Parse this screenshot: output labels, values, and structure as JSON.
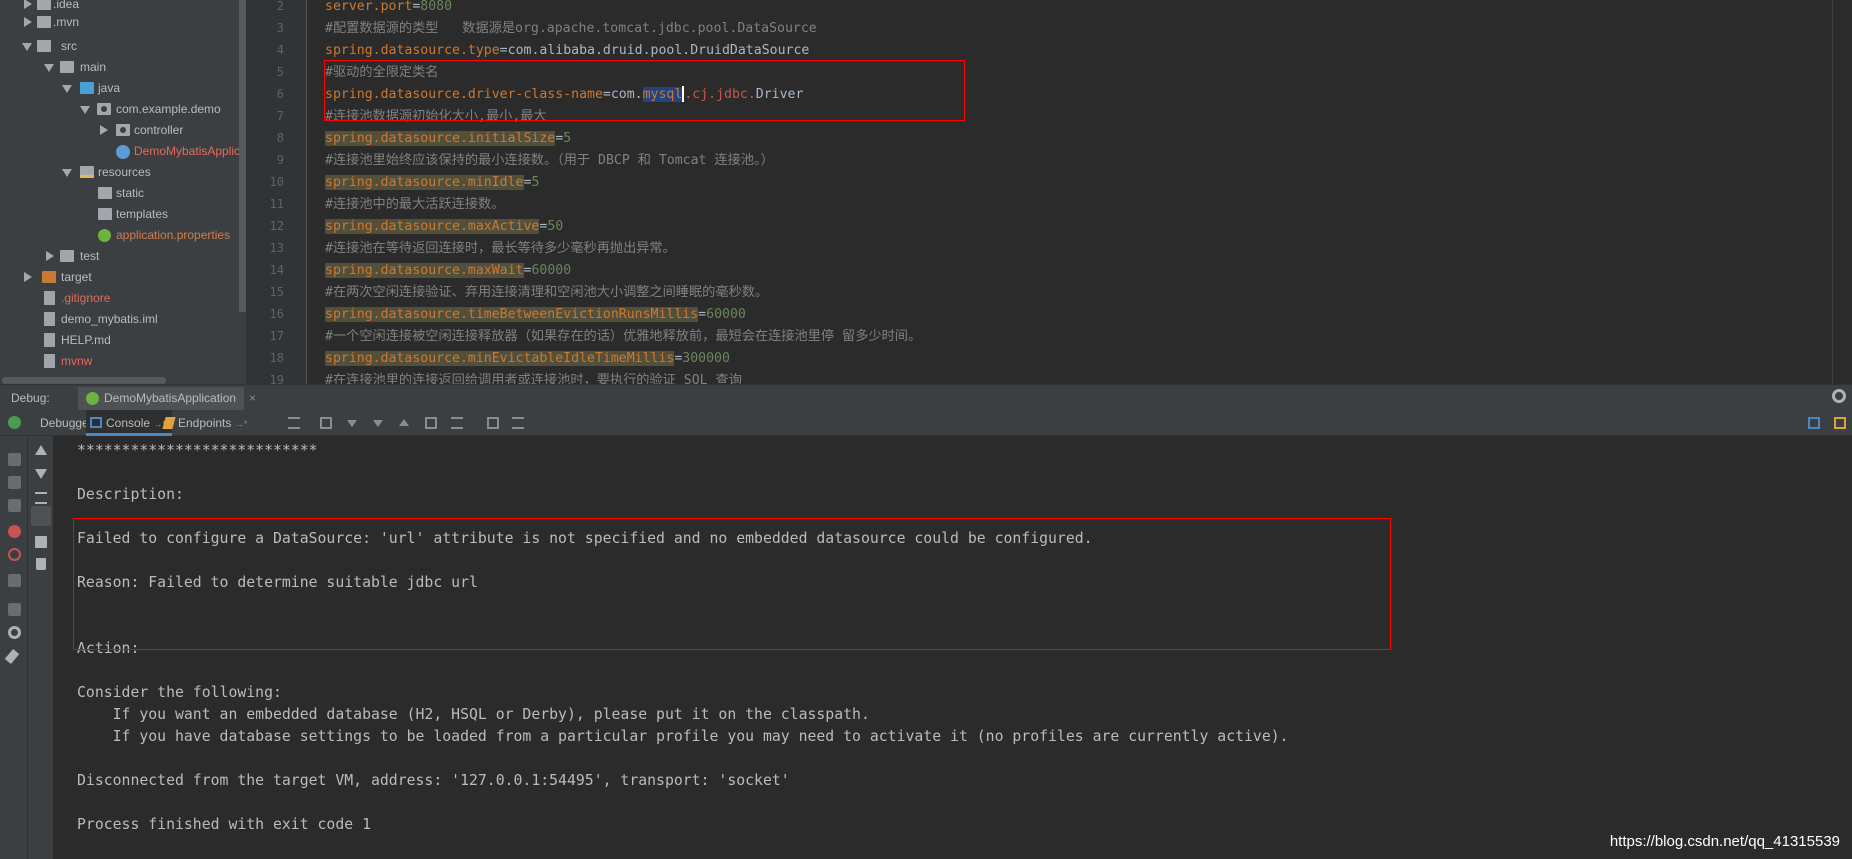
{
  "project_tree": {
    "items": [
      {
        "label": ".idea",
        "icon": "folder-icon"
      },
      {
        "label": ".mvn",
        "icon": "folder-icon"
      },
      {
        "label": "src",
        "icon": "folder-icon"
      },
      {
        "label": "main",
        "icon": "folder-icon"
      },
      {
        "label": "java",
        "icon": "source-folder-icon"
      },
      {
        "label": "com.example.demo",
        "icon": "package-icon"
      },
      {
        "label": "controller",
        "icon": "package-icon"
      },
      {
        "label": "DemoMybatisApplic",
        "icon": "spring-boot-class-icon"
      },
      {
        "label": "resources",
        "icon": "resources-folder-icon"
      },
      {
        "label": "static",
        "icon": "folder-icon"
      },
      {
        "label": "templates",
        "icon": "folder-icon"
      },
      {
        "label": "application.properties",
        "icon": "spring-config-icon"
      },
      {
        "label": "test",
        "icon": "folder-icon"
      },
      {
        "label": "target",
        "icon": "excluded-folder-icon"
      },
      {
        "label": ".gitignore",
        "icon": "file-icon"
      },
      {
        "label": "demo_mybatis.iml",
        "icon": "module-file-icon"
      },
      {
        "label": "HELP.md",
        "icon": "markdown-file-icon"
      },
      {
        "label": "mvnw",
        "icon": "file-icon"
      }
    ]
  },
  "editor": {
    "line_numbers": [
      "2",
      "3",
      "4",
      "5",
      "6",
      "7",
      "8",
      "9",
      "10",
      "11",
      "12",
      "13",
      "14",
      "15",
      "16",
      "17",
      "18",
      "19"
    ],
    "lines": {
      "l2_key": "server.port",
      "l2_eq": "=",
      "l2_val": "8080",
      "l3": "#配置数据源的类型   数据源是org.apache.tomcat.jdbc.pool.DataSource",
      "l4_key": "spring.datasource.type",
      "l4_eq": "=",
      "l4_val": "com.alibaba.druid.pool.DruidDataSource",
      "l5": "#驱动的全限定类名",
      "l6_key": "spring.datasource.driver-class-name",
      "l6_eq": "=",
      "l6_val1": "com.",
      "l6_sel": "mysql",
      "l6_val2": ".cj.jdbc.",
      "l6_val3": "Driver",
      "l7": "#连接池数据源初始化大小,最小,最大",
      "l8_key": "spring.datasource.initialSize",
      "l8_eq": "=",
      "l8_val": "5",
      "l9": "#连接池里始终应该保持的最小连接数。（用于 DBCP 和 Tomcat 连接池。）",
      "l10_key": "spring.datasource.minIdle",
      "l10_eq": "=",
      "l10_val": "5",
      "l11": "#连接池中的最大活跃连接数。",
      "l12_key": "spring.datasource.maxActive",
      "l12_eq": "=",
      "l12_val": "50",
      "l13": "#连接池在等待返回连接时，最长等待多少毫秒再抛出异常。",
      "l14_key": "spring.datasource.maxWait",
      "l14_eq": "=",
      "l14_val": "60000",
      "l15": "#在两次空闲连接验证、弃用连接清理和空闲池大小调整之间睡眠的毫秒数。",
      "l16_key": "spring.datasource.timeBetweenEvictionRunsMillis",
      "l16_eq": "=",
      "l16_val": "60000",
      "l17": "#一个空闲连接被空闲连接释放器（如果存在的话）优雅地释放前，最短会在连接池里停 留多少时间。",
      "l18_key": "spring.datasource.minEvictableIdleTimeMillis",
      "l18_eq": "=",
      "l18_val": "300000",
      "l19": "#在连接池里的连接返回给调用者或连接池时，要执行的验证 SQL 查询"
    }
  },
  "debug": {
    "title": "Debug:",
    "run_tab": "DemoMybatisApplication",
    "close_symbol": "×",
    "tabs": {
      "debugger": "Debugger",
      "console": "Console",
      "console_suffix": "→*",
      "endpoints": "Endpoints",
      "endpoints_suffix": "→*"
    }
  },
  "console": {
    "lines": [
      "***************************",
      "",
      "Description:",
      "",
      "Failed to configure a DataSource: 'url' attribute is not specified and no embedded datasource could be configured.",
      "",
      "Reason: Failed to determine suitable jdbc url",
      "",
      "",
      "Action:",
      "",
      "Consider the following:",
      "    If you want an embedded database (H2, HSQL or Derby), please put it on the classpath.",
      "    If you have database settings to be loaded from a particular profile you may need to activate it (no profiles are currently active).",
      "",
      "Disconnected from the target VM, address: '127.0.0.1:54495', transport: 'socket'",
      "",
      "Process finished with exit code 1"
    ]
  },
  "watermark": "https://blog.csdn.net/qq_41315539",
  "colors": {
    "highlight_box": "#ff0000",
    "selection": "#214283",
    "keyword": "#cc7832",
    "number": "#6a8759",
    "comment": "#808080"
  }
}
